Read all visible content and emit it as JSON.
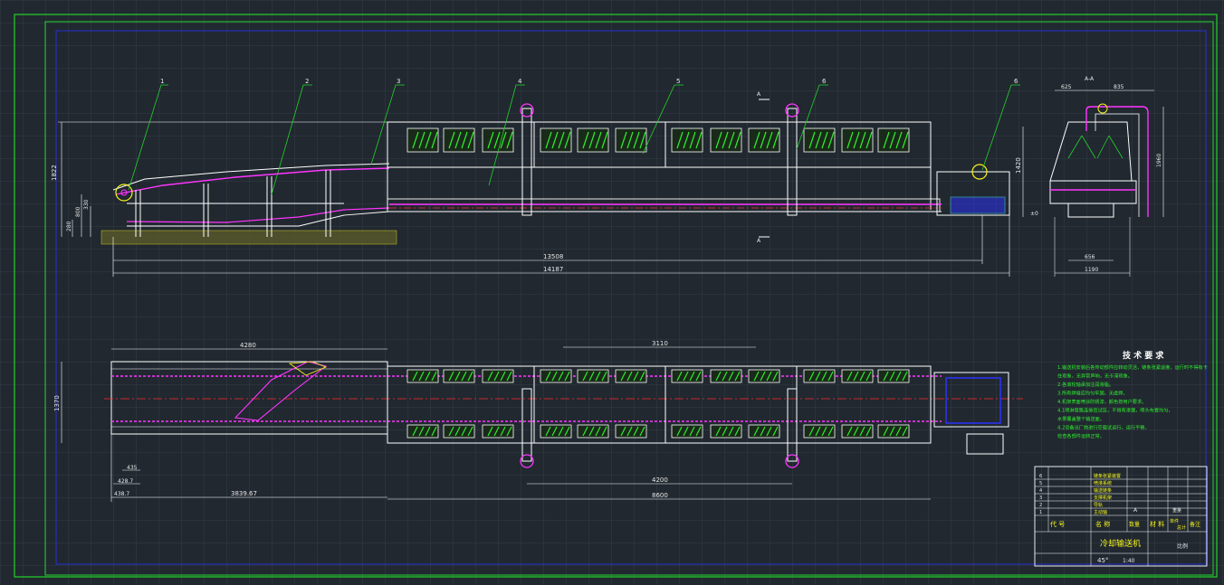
{
  "colors": {
    "background": "#212830",
    "frame": "#22d32b",
    "inner_frame": "#2b32ff",
    "geometry": "#ffffff",
    "magenta": "#ff35ff",
    "red": "#ff2a2a",
    "cyan": "#44e0ff",
    "yellow": "#f5f51c",
    "green": "#2ef02e"
  },
  "side_view": {
    "part_labels": [
      "1",
      "2",
      "3",
      "4",
      "5",
      "6",
      "6"
    ],
    "section_marks": [
      "A",
      "A",
      "A-A"
    ],
    "dims": {
      "height_left": "1822",
      "d800": "800",
      "d330": "330",
      "d280": "280",
      "height_right": "1420",
      "zero_right": "±0",
      "length_inner": "13508",
      "length_total": "14187"
    }
  },
  "end_view": {
    "dims": {
      "w_left": "625",
      "w_right": "835",
      "height": "1960",
      "w_bottom": "656",
      "w_total": "1190"
    }
  },
  "top_view": {
    "dims": {
      "left_length": "4280",
      "mid_span": "3110",
      "width": "1370",
      "d435": "435",
      "d428": "428.7",
      "d438": "438.7",
      "length_left": "3839.67",
      "pitch": "4200",
      "length_right": "8600"
    }
  },
  "tech_requirements": {
    "title": "技 术 要 求",
    "lines": [
      "1.输送机安装后各传动部件应转动灵活，链条张紧适度，运行时不得有卡",
      "  住现象，无异常声响，无卡滞现象。",
      "2.各滚轮轴承加注润滑脂。",
      "3.所有焊缝应均匀牢固，无虚焊。",
      "4.机架表面喷涂防锈漆，颜色按用户要求。",
      "4.1喷淋管路连接后试压，不得有渗漏，喷头布置均匀，",
      "  水雾覆盖整个输送面。",
      "4.2设备出厂前进行空载试运行，运行平稳，",
      "  检查各部件运转正常。"
    ]
  },
  "title_block": {
    "headers": [
      "代 号",
      "名 称",
      "数量",
      "材 料",
      "单件",
      "总计",
      "备注"
    ],
    "row_numbers": [
      "6",
      "5",
      "4",
      "3",
      "2",
      "1"
    ],
    "row_names": [
      "链条张紧装置",
      "喷淋系统",
      "输送链条",
      "支撑机架",
      "导轨",
      "主动轴"
    ],
    "scale_mark": "A",
    "weight_header": "重量",
    "title": "冷却输送机",
    "drawing_no": "45°",
    "scale": "1:40",
    "ratio": "比例"
  }
}
